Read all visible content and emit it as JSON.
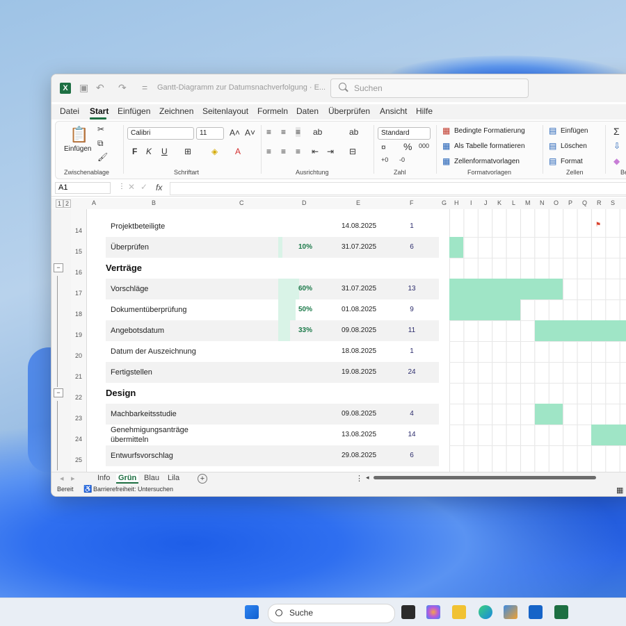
{
  "window": {
    "title": "Gantt-Diagramm zur Datumsnachverfolgung · E...",
    "search_placeholder": "Suchen"
  },
  "menu": [
    "Datei",
    "Start",
    "Einfügen",
    "Zeichnen",
    "Seitenlayout",
    "Formeln",
    "Daten",
    "Überprüfen",
    "Ansicht",
    "Hilfe"
  ],
  "ribbon": {
    "clipboard": {
      "paste": "Einfügen",
      "label": "Zwischenablage"
    },
    "font": {
      "name": "Calibri",
      "size": "11",
      "label": "Schriftart",
      "bold": "F",
      "italic": "K",
      "underline": "U"
    },
    "alignment": {
      "label": "Ausrichtung"
    },
    "number": {
      "format": "Standard",
      "label": "Zahl"
    },
    "styles": {
      "conditional": "Bedingte Formatierung",
      "as_table": "Als Tabelle formatieren",
      "cell_styles": "Zellenformatvorlagen",
      "label": "Formatvorlagen"
    },
    "cells": {
      "insert": "Einfügen",
      "delete": "Löschen",
      "format": "Format",
      "label": "Zellen"
    },
    "editing": {
      "label": "Be"
    }
  },
  "formula_bar": {
    "name_box": "A1",
    "fx": "fx"
  },
  "columns": [
    "A",
    "B",
    "C",
    "D",
    "E",
    "F",
    "G",
    "H",
    "I",
    "J",
    "K",
    "L",
    "M",
    "N",
    "O",
    "P",
    "Q",
    "R",
    "S"
  ],
  "rows": [
    {
      "num": "14",
      "type": "task",
      "name": "Projektbeteiligte",
      "pct": "",
      "date": "14.08.2025",
      "days": "1",
      "shaded": false
    },
    {
      "num": "15",
      "type": "task",
      "name": "Überprüfen",
      "pct": "10%",
      "date": "31.07.2025",
      "days": "6",
      "shaded": true
    },
    {
      "num": "16",
      "type": "section",
      "name": "Verträge"
    },
    {
      "num": "17",
      "type": "task",
      "name": "Vorschläge",
      "pct": "60%",
      "date": "31.07.2025",
      "days": "13",
      "shaded": true
    },
    {
      "num": "18",
      "type": "task",
      "name": "Dokumentüberprüfung",
      "pct": "50%",
      "date": "01.08.2025",
      "days": "9",
      "shaded": false
    },
    {
      "num": "19",
      "type": "task",
      "name": "Angebotsdatum",
      "pct": "33%",
      "date": "09.08.2025",
      "days": "11",
      "shaded": true
    },
    {
      "num": "20",
      "type": "task",
      "name": "Datum der Auszeichnung",
      "pct": "",
      "date": "18.08.2025",
      "days": "1",
      "shaded": false
    },
    {
      "num": "21",
      "type": "task",
      "name": "Fertigstellen",
      "pct": "",
      "date": "19.08.2025",
      "days": "24",
      "shaded": true
    },
    {
      "num": "22",
      "type": "section",
      "name": "Design"
    },
    {
      "num": "23",
      "type": "task",
      "name": "Machbarkeitsstudie",
      "pct": "",
      "date": "09.08.2025",
      "days": "4",
      "shaded": true
    },
    {
      "num": "24",
      "type": "task",
      "name": "Genehmigungsanträge übermitteln",
      "pct": "",
      "date": "13.08.2025",
      "days": "14",
      "shaded": false
    },
    {
      "num": "25",
      "type": "task",
      "name": "Entwurfsvorschlag",
      "pct": "",
      "date": "29.08.2025",
      "days": "6",
      "shaded": true
    }
  ],
  "sheet_tabs": [
    "Info",
    "Grün",
    "Blau",
    "Lila"
  ],
  "active_tab": "Grün",
  "status": {
    "ready": "Bereit",
    "accessibility": "Barrierefreiheit: Untersuchen"
  },
  "taskbar": {
    "search": "Suche"
  },
  "colors": {
    "accent": "#1d6f42",
    "gantt_bar": "#9fe5c6",
    "progress": "#d9f3e7"
  }
}
